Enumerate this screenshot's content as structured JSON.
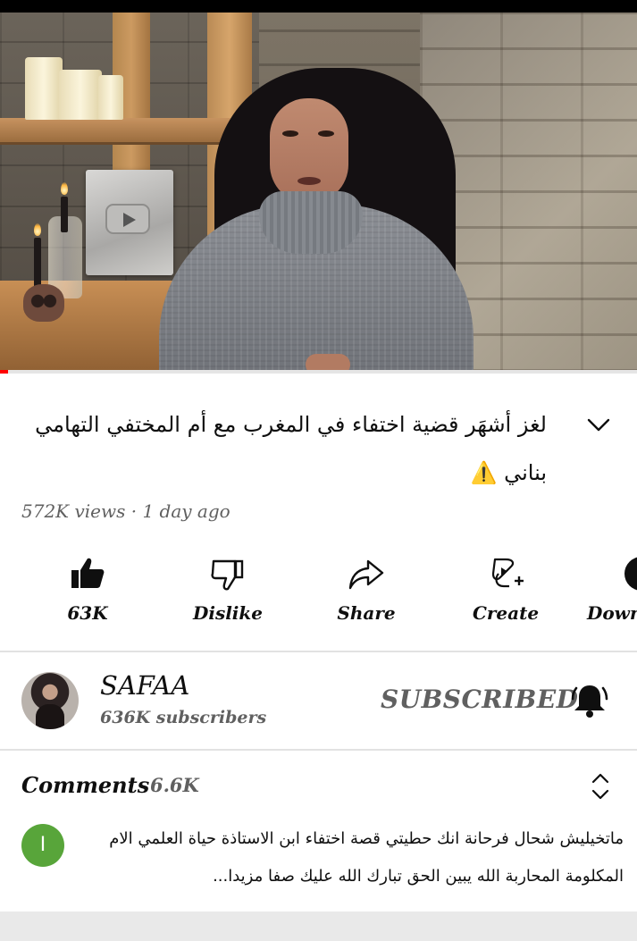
{
  "video": {
    "progress_fraction": 0.012,
    "title": "لغز أشهَر قضية اختفاء في المغرب مع أم المختفي التهامي بناني ⚠️",
    "meta": "572K views · 1 day ago"
  },
  "actions": [
    {
      "icon": "thumb-up-filled-icon",
      "label": "63K"
    },
    {
      "icon": "thumb-down-icon",
      "label": "Dislike"
    },
    {
      "icon": "share-icon",
      "label": "Share"
    },
    {
      "icon": "create-icon",
      "label": "Create"
    },
    {
      "icon": "download-icon",
      "label": "Down"
    }
  ],
  "channel": {
    "name": "SAFAA",
    "subscribers": "636K subscribers",
    "subscribe_state": "SUBSCRIBED"
  },
  "comments": {
    "heading": "Comments",
    "count": "6.6K",
    "first": {
      "avatar_letter": "I",
      "text": "ماتخيليش شحال فرحانة انك حطيتي قصة اختفاء ابن الاستاذة حياة العلمي الام المكلومة المحاربة الله يبين الحق تبارك الله عليك صفا مزيدا..."
    }
  },
  "colors": {
    "progress": "#ff0000",
    "comment_avatar": "#58a53a",
    "secondary_text": "#606060"
  }
}
